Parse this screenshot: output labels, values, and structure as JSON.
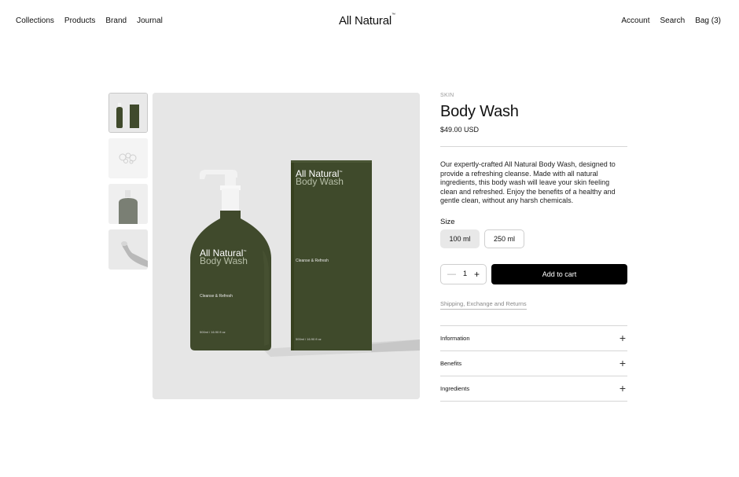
{
  "header": {
    "nav_left": [
      "Collections",
      "Products",
      "Brand",
      "Journal"
    ],
    "logo": "All Natural",
    "logo_tm": "™",
    "nav_right": [
      "Account",
      "Search",
      "Bag (3)"
    ]
  },
  "gallery": {
    "label_title": "All Natural",
    "label_tm": "™",
    "label_product": "Body Wash",
    "bottle_tag": "Cleanse & Refresh",
    "bottle_volume": "500ml / 16.90 fl oz",
    "box_tag": "Cleanse & Refresh",
    "box_volume": "500ml / 16.90 fl oz",
    "product_color": "#404a2c",
    "background_color": "#e6e6e6"
  },
  "product": {
    "category": "SKIN",
    "title": "Body Wash",
    "price": "$49.00 USD",
    "description": "Our expertly-crafted All Natural Body Wash, designed to provide a refreshing cleanse. Made with all natural ingredients, this body wash will leave your skin feeling clean and refreshed. Enjoy the benefits of a healthy and gentle clean, without any harsh chemicals.",
    "size_label": "Size",
    "sizes": [
      "100 ml",
      "250 ml"
    ],
    "selected_size": "100 ml",
    "quantity": "1",
    "add_to_cart": "Add to cart",
    "shipping_link": "Shipping, Exchange and Returns",
    "accordion": [
      "Information",
      "Benefits",
      "Ingredients"
    ]
  }
}
